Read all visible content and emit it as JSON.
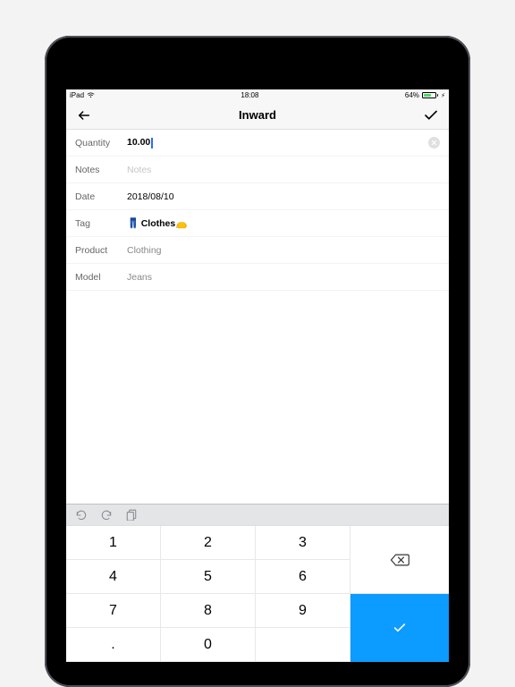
{
  "status": {
    "device": "iPad",
    "time": "18:08",
    "battery_pct": "64%"
  },
  "nav": {
    "title": "Inward"
  },
  "form": {
    "quantity_label": "Quantity",
    "quantity_value": "10.00",
    "notes_label": "Notes",
    "notes_placeholder": "Notes",
    "date_label": "Date",
    "date_value": "2018/08/10",
    "tag_label": "Tag",
    "tag_emoji": "👖",
    "tag_value": "Clothes",
    "tag_emoji2": "👝",
    "product_label": "Product",
    "product_value": "Clothing",
    "model_label": "Model",
    "model_value": "Jeans"
  },
  "keypad": {
    "k1": "1",
    "k2": "2",
    "k3": "3",
    "k4": "4",
    "k5": "5",
    "k6": "6",
    "k7": "7",
    "k8": "8",
    "k9": "9",
    "k0": "0",
    "kdot": "."
  }
}
